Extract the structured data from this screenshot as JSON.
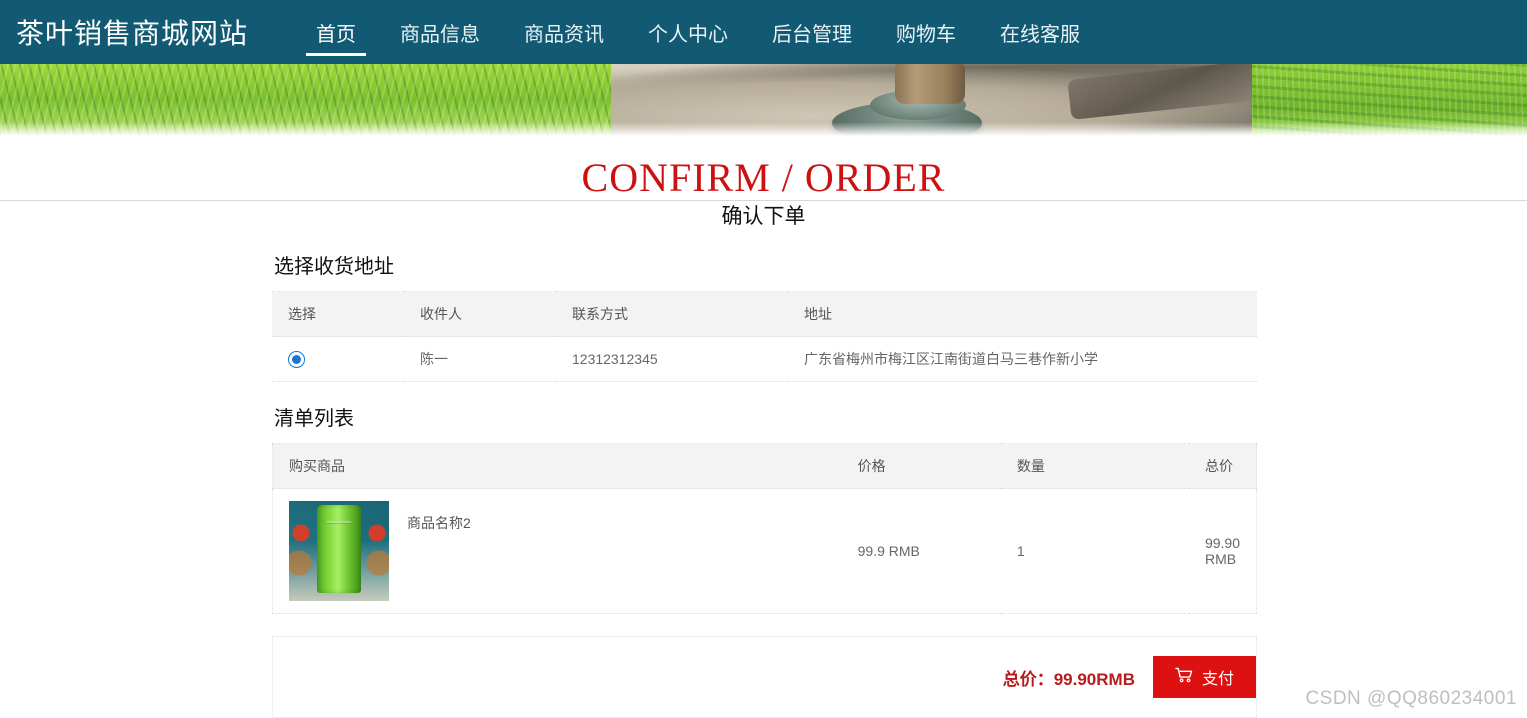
{
  "header": {
    "brand": "茶叶销售商城网站",
    "nav": [
      {
        "label": "首页",
        "active": true
      },
      {
        "label": "商品信息",
        "active": false
      },
      {
        "label": "商品资讯",
        "active": false
      },
      {
        "label": "个人中心",
        "active": false
      },
      {
        "label": "后台管理",
        "active": false
      },
      {
        "label": "购物车",
        "active": false
      },
      {
        "label": "在线客服",
        "active": false
      }
    ]
  },
  "page": {
    "title_en": "CONFIRM / ORDER",
    "title_cn": "确认下单"
  },
  "address_section": {
    "title": "选择收货地址",
    "columns": [
      "选择",
      "收件人",
      "联系方式",
      "地址"
    ],
    "rows": [
      {
        "selected": true,
        "recipient": "陈一",
        "phone": "12312312345",
        "address": "广东省梅州市梅江区江南街道白马三巷作新小学"
      }
    ]
  },
  "items_section": {
    "title": "清单列表",
    "columns": [
      "购买商品",
      "价格",
      "数量",
      "总价"
    ],
    "rows": [
      {
        "name": "商品名称2",
        "image_alt": "碧螺春绿茶罐",
        "price": "99.9 RMB",
        "quantity": "1",
        "subtotal": "99.90 RMB"
      }
    ]
  },
  "summary": {
    "total_text": "总价：99.90RMB",
    "pay_label": "支付",
    "pay_icon": "shopping-cart-icon"
  },
  "watermark": "CSDN @QQ860234001",
  "colors": {
    "nav_bg": "#125a73",
    "title_red": "#cc1111",
    "pay_red": "#dd1111",
    "total_red": "#b81b1b",
    "radio_blue": "#1878d0"
  }
}
